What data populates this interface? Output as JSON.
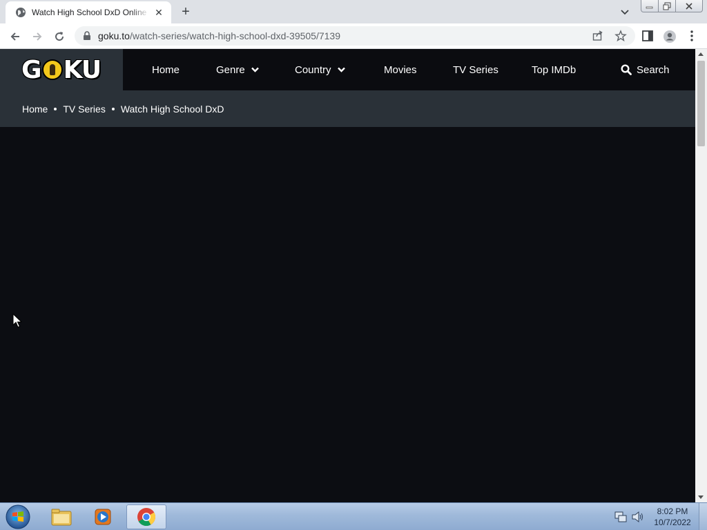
{
  "browser": {
    "tab_title": "Watch High School DxD Online F",
    "url_domain": "goku.to",
    "url_path": "/watch-series/watch-high-school-dxd-39505/7139"
  },
  "site": {
    "logo_parts": [
      "G",
      "KU"
    ],
    "nav": [
      {
        "label": "Home",
        "icon": "none"
      },
      {
        "label": "Genre",
        "icon": "chevron-down-icon"
      },
      {
        "label": "Country",
        "icon": "chevron-down-icon"
      },
      {
        "label": "Movies",
        "icon": "none"
      },
      {
        "label": "TV Series",
        "icon": "none"
      },
      {
        "label": "Top IMDb",
        "icon": "none"
      },
      {
        "label": "Search",
        "icon": "search-icon"
      }
    ],
    "breadcrumb": [
      "Home",
      "TV Series",
      "Watch High School DxD"
    ]
  },
  "taskbar": {
    "time": "8:02 PM",
    "date": "10/7/2022"
  },
  "colors": {
    "header_bg": "#2a3138",
    "nav_bg": "#0b0c10",
    "player_bg": "#0c0d12",
    "logo_accent": "#f3c81b"
  }
}
